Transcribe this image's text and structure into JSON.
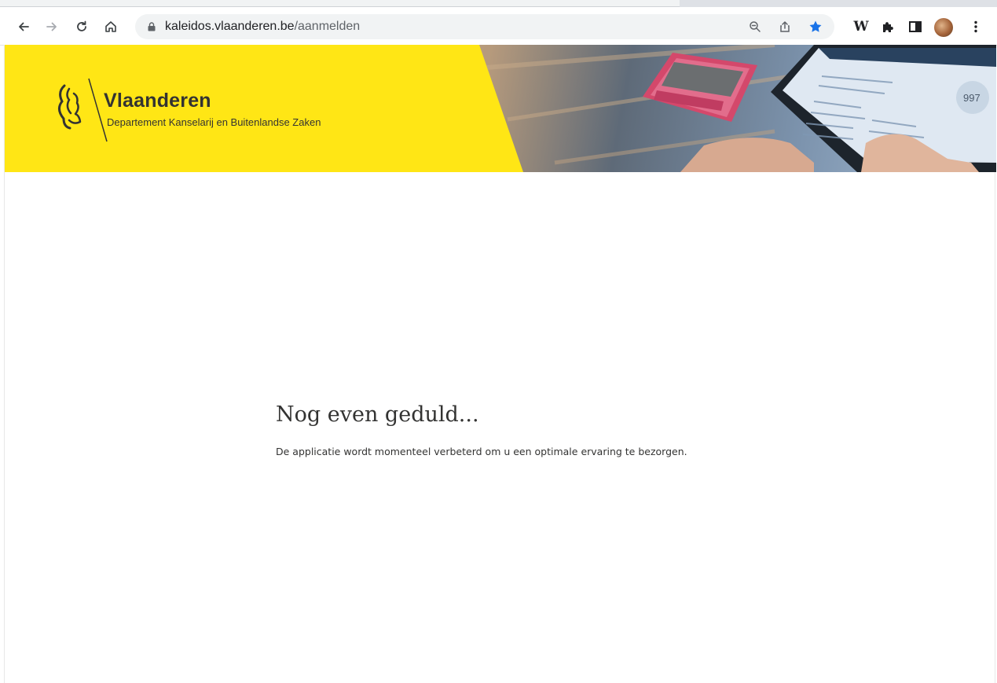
{
  "browser": {
    "url_host": "kaleidos.vlaanderen.be",
    "url_path": "/aanmelden",
    "icons": {
      "back": "arrow-left-icon",
      "forward": "arrow-right-icon",
      "reload": "reload-icon",
      "home": "home-icon",
      "lock": "lock-icon",
      "zoom": "zoom-icon",
      "share": "share-icon",
      "bookmark": "star-icon",
      "wikipedia": "wikipedia-icon",
      "extensions": "puzzle-icon",
      "sidepanel": "side-panel-icon",
      "menu": "kebab-menu-icon"
    },
    "bookmark_color": "#1a73e8"
  },
  "header": {
    "brand": "Vlaanderen",
    "department": "Departement Kanselarij en Buitenlandse Zaken",
    "brand_color": "#ffe615",
    "tablet_number": "997"
  },
  "main": {
    "title": "Nog even geduld...",
    "message": "De applicatie wordt momenteel verbeterd om u een optimale ervaring te bezorgen."
  }
}
